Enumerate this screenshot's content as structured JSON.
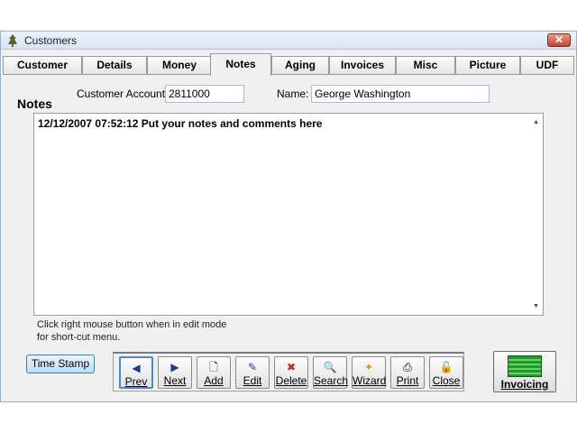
{
  "window": {
    "title": "Customers",
    "close_glyph": "✕"
  },
  "tabs": [
    {
      "label": "Customer"
    },
    {
      "label": "Details"
    },
    {
      "label": "Money"
    },
    {
      "label": "Notes"
    },
    {
      "label": "Aging"
    },
    {
      "label": "Invoices"
    },
    {
      "label": "Misc"
    },
    {
      "label": "Picture"
    },
    {
      "label": "UDF"
    }
  ],
  "active_tab": "Notes",
  "form": {
    "section_title": "Notes",
    "account_label": "Customer Account:",
    "account_value": "2811000",
    "name_label": "Name:",
    "name_value": "George Washington"
  },
  "memo": {
    "text": "12/12/2007 07:52:12 Put your notes and comments here",
    "scroll_up": "▲",
    "scroll_down": "▼"
  },
  "hint": "Click right mouse button when in edit mode for short-cut menu.",
  "buttons": {
    "time_stamp": "Time Stamp",
    "nav": [
      {
        "label": "Prev",
        "icon": "◀"
      },
      {
        "label": "Next",
        "icon": "▶"
      },
      {
        "label": "Add",
        "icon": "🗋"
      },
      {
        "label": "Edit",
        "icon": "✎"
      },
      {
        "label": "Delete",
        "icon": "✖"
      },
      {
        "label": "Search",
        "icon": "🔍"
      },
      {
        "label": "Wizard",
        "icon": "✦"
      },
      {
        "label": "Print",
        "icon": "⎙"
      },
      {
        "label": "Close",
        "icon": "🔓"
      }
    ],
    "invoicing": "Invoicing"
  },
  "colors": {
    "accent": "#3c7fb1",
    "nav_arrow": "#1a3f8a",
    "invoice_green": "#1f9a2a"
  }
}
